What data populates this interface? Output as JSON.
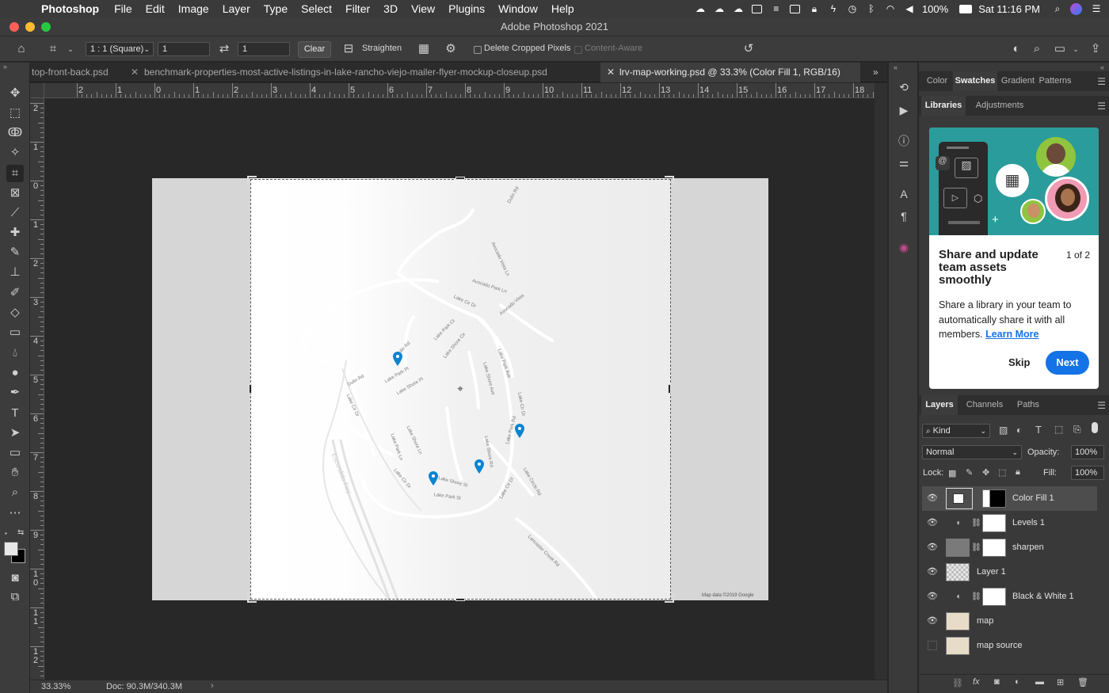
{
  "menubar": {
    "app": "Photoshop",
    "items": [
      "File",
      "Edit",
      "Image",
      "Layer",
      "Type",
      "Select",
      "Filter",
      "3D",
      "View",
      "Plugins",
      "Window",
      "Help"
    ],
    "battery": "100%",
    "clock": "Sat 11:16 PM"
  },
  "window": {
    "title": "Adobe Photoshop 2021"
  },
  "options": {
    "ratio": "1 : 1 (Square)",
    "width": "1",
    "height": "1",
    "clear": "Clear",
    "straighten": "Straighten",
    "delete_cropped": "Delete Cropped Pixels",
    "content_aware": "Content-Aware"
  },
  "tabs": [
    {
      "label": "top-front-back.psd"
    },
    {
      "label": "benchmark-properties-most-active-listings-in-lake-rancho-viejo-mailer-flyer-mockup-closeup.psd"
    },
    {
      "label": "lrv-map-working.psd @ 33.3% (Color Fill 1, RGB/16)"
    }
  ],
  "ruler_top": [
    "2",
    "1",
    "0",
    "1",
    "2",
    "3",
    "4",
    "5",
    "6",
    "7",
    "8",
    "9",
    "10",
    "11",
    "12",
    "13",
    "14",
    "15",
    "16",
    "17",
    "18"
  ],
  "ruler_left": [
    "2",
    "1",
    "0",
    "1",
    "2",
    "3",
    "4",
    "5",
    "6",
    "7",
    "8",
    "9",
    "1\n0",
    "1\n1",
    "1\n2"
  ],
  "status": {
    "zoom": "33.33%",
    "doc": "Doc: 90.3M/340.3M"
  },
  "panels": {
    "top_tabs": [
      "Color",
      "Swatches",
      "Gradient",
      "Patterns"
    ],
    "mid_tabs": [
      "Libraries",
      "Adjustments"
    ],
    "library_card": {
      "title": "Share and update team assets smoothly",
      "counter": "1 of 2",
      "body": "Share a library in your team to automatically share it with all members.",
      "link": "Learn More",
      "skip": "Skip",
      "next": "Next"
    },
    "layer_tabs": [
      "Layers",
      "Channels",
      "Paths"
    ],
    "kind": "Kind",
    "blend": "Normal",
    "opacity_label": "Opacity:",
    "opacity": "100%",
    "lock_label": "Lock:",
    "fill_label": "Fill:",
    "fill": "100%"
  },
  "layers": [
    {
      "name": "Color Fill 1",
      "visible": true,
      "selected": true
    },
    {
      "name": "Levels 1",
      "visible": true
    },
    {
      "name": "sharpen",
      "visible": true
    },
    {
      "name": "Layer 1",
      "visible": true
    },
    {
      "name": "Black & White 1",
      "visible": true
    },
    {
      "name": "map",
      "visible": true
    },
    {
      "name": "map source",
      "visible": false
    }
  ],
  "map": {
    "attribution": "Map data ©2019 Google",
    "streets": [
      "Dulin Rd",
      "Avocado Vista Ln",
      "Avocado Park Ln",
      "Lake Cir Dr",
      "Avocado Vista",
      "Lake Park Ct",
      "Dulin Rd",
      "Lake Shore Cir",
      "Lake Park Ave",
      "Lake Park Pl",
      "Lake Shore Ave",
      "Lake Shore Pl",
      "Dulin Rd",
      "Lake Cir Dr",
      "Lake Cir Dr",
      "Lake Shore Ln",
      "Lake Park Ln",
      "Lake Shore Rd",
      "Lake Park Rd",
      "Escondido Fwy",
      "Lake Cir Dr",
      "Lake Shore St",
      "Lake Circle Rd",
      "Lake Cir Dr",
      "Lake Park St",
      "Lancaster Creek Rd"
    ]
  },
  "colors": {
    "accent": "#1473e6",
    "pin": "#0b84d0",
    "teal": "#2a9c9b"
  }
}
